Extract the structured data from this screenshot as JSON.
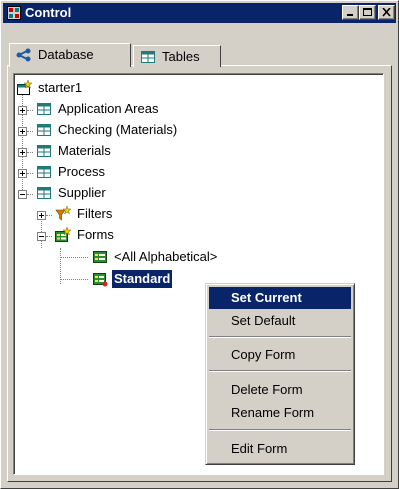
{
  "window": {
    "title": "Control",
    "icon": "control-window-icon",
    "buttons": [
      "minimize",
      "maximize",
      "close"
    ]
  },
  "tabs": [
    {
      "label": "Database",
      "icon": "database-network-icon",
      "active": true
    },
    {
      "label": "Tables",
      "icon": "table-icon",
      "active": false
    }
  ],
  "tree": {
    "root": {
      "label": "starter1",
      "icon": "database-root-icon"
    },
    "items": [
      {
        "label": "Application Areas",
        "icon": "table-icon",
        "expander": "plus"
      },
      {
        "label": "Checking (Materials)",
        "icon": "table-icon",
        "expander": "plus"
      },
      {
        "label": "Materials",
        "icon": "table-icon",
        "expander": "plus"
      },
      {
        "label": "Process",
        "icon": "table-icon",
        "expander": "plus"
      },
      {
        "label": "Supplier",
        "icon": "table-icon",
        "expander": "minus"
      },
      {
        "label": "Filters",
        "icon": "filter-icon",
        "expander": "plus"
      },
      {
        "label": "Forms",
        "icon": "forms-folder-icon",
        "expander": "minus"
      },
      {
        "label": "<All Alphabetical>",
        "icon": "form-icon",
        "expander": ""
      },
      {
        "label": "Standard",
        "icon": "form-current-icon",
        "expander": "",
        "selected": true
      }
    ]
  },
  "context_menu": {
    "items": [
      {
        "label": "Set Current",
        "highlighted": true
      },
      {
        "label": "Set Default"
      },
      {
        "separator": true
      },
      {
        "label": "Copy Form"
      },
      {
        "separator": true
      },
      {
        "label": "Delete Form"
      },
      {
        "label": "Rename Form"
      },
      {
        "separator": true
      },
      {
        "label": "Edit Form"
      }
    ]
  },
  "colors": {
    "titlebar": "#0a246a",
    "face": "#d4d0c8",
    "highlight": "#0a246a",
    "table_icon": "#1f7a7a",
    "form_icon": "#2e8b2e"
  }
}
